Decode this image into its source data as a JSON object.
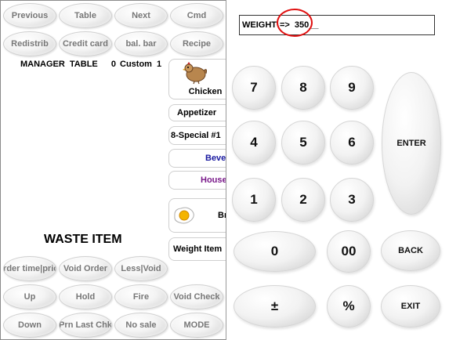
{
  "top_buttons": [
    "Previous",
    "Table",
    "Next",
    "Cmd",
    "Redistrib",
    "Credit card",
    "bal. bar",
    "Recipe"
  ],
  "status_line": {
    "mode": "MANAGER",
    "table": "TABLE",
    "seq": "0",
    "custom": "Custom",
    "count": "1"
  },
  "waste_title": "WASTE ITEM",
  "bottom_buttons": [
    "Order time|price",
    "Void Order",
    "Less|Void",
    "Up",
    "Hold",
    "Fire",
    "Void Check",
    "Down",
    "Prn Last Chk",
    "No sale",
    "MODE"
  ],
  "categories": {
    "chicken": "Chicken",
    "appetizer": "Appetizer",
    "special": "8-Special #1",
    "beverage": "Beve",
    "house": "House",
    "breakfast": "Br",
    "weight_item": "Weight Item"
  },
  "colors": {
    "beverage": "#1a1aa0",
    "house": "#7a1a8a",
    "highlight": "#e01010"
  },
  "display": {
    "label": "WEIGHT",
    "arrow": "=>",
    "value": "350__"
  },
  "keypad": {
    "k7": "7",
    "k8": "8",
    "k9": "9",
    "k4": "4",
    "k5": "5",
    "k6": "6",
    "k1": "1",
    "k2": "2",
    "k3": "3",
    "k0": "0",
    "k00": "00",
    "enter": "ENTER",
    "back": "BACK",
    "exit": "EXIT",
    "plusminus": "±",
    "percent": "%"
  }
}
